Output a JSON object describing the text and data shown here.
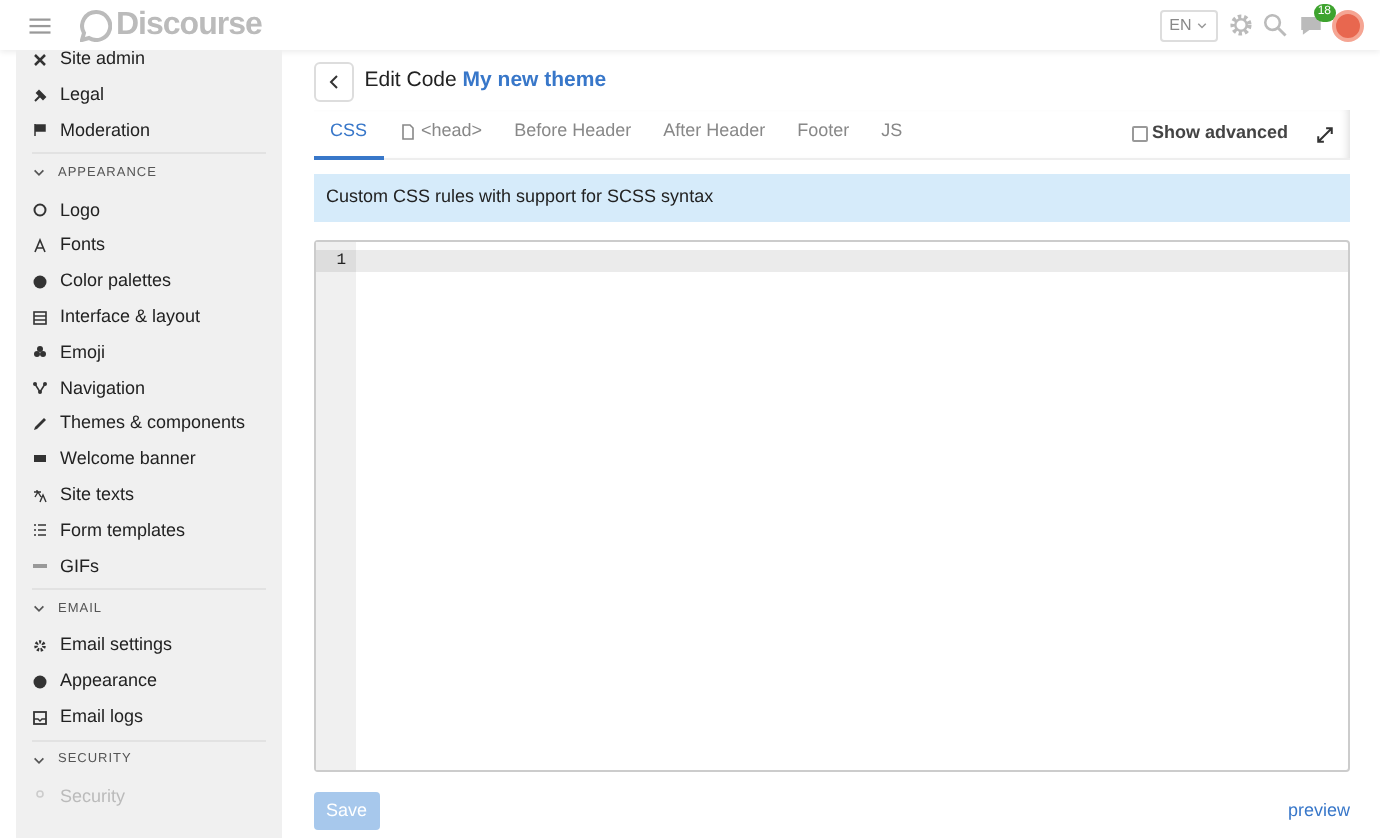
{
  "header": {
    "logo": "Discourse",
    "language": "EN",
    "notification_count": "18"
  },
  "sidebar": {
    "sections": [
      {
        "items": [
          {
            "label": "Site admin"
          },
          {
            "label": "Legal"
          },
          {
            "label": "Moderation"
          }
        ]
      },
      {
        "title": "APPEARANCE",
        "expanded": true,
        "items": [
          {
            "label": "Logo"
          },
          {
            "label": "Fonts"
          },
          {
            "label": "Color palettes"
          },
          {
            "label": "Interface & layout"
          },
          {
            "label": "Emoji"
          },
          {
            "label": "Navigation"
          },
          {
            "label": "Themes & components"
          },
          {
            "label": "Welcome banner"
          },
          {
            "label": "Site texts"
          },
          {
            "label": "Form templates"
          },
          {
            "label": "GIFs"
          }
        ]
      },
      {
        "title": "EMAIL",
        "expanded": true,
        "items": [
          {
            "label": "Email settings"
          },
          {
            "label": "Appearance"
          },
          {
            "label": "Email logs"
          }
        ]
      },
      {
        "title": "SECURITY",
        "expanded": true,
        "items": [
          {
            "label": "Security",
            "disabled": true
          }
        ]
      }
    ]
  },
  "page": {
    "title": "Edit Code",
    "theme_name": "My new theme",
    "tabs": [
      {
        "label": "CSS",
        "selected": true
      },
      {
        "label": "<head>",
        "selected": false
      },
      {
        "label": "Before Header",
        "selected": false
      },
      {
        "label": "After Header",
        "selected": false
      },
      {
        "label": "Footer",
        "selected": false
      },
      {
        "label": "JS",
        "selected": false
      }
    ],
    "show_advanced": {
      "label": "Show advanced",
      "checked": false
    },
    "description": "Custom CSS rules with support for SCSS syntax",
    "editor": {
      "line_numbers": [
        "1"
      ]
    },
    "save_button": {
      "label": "Save",
      "disabled": true
    },
    "preview_link": "preview"
  }
}
